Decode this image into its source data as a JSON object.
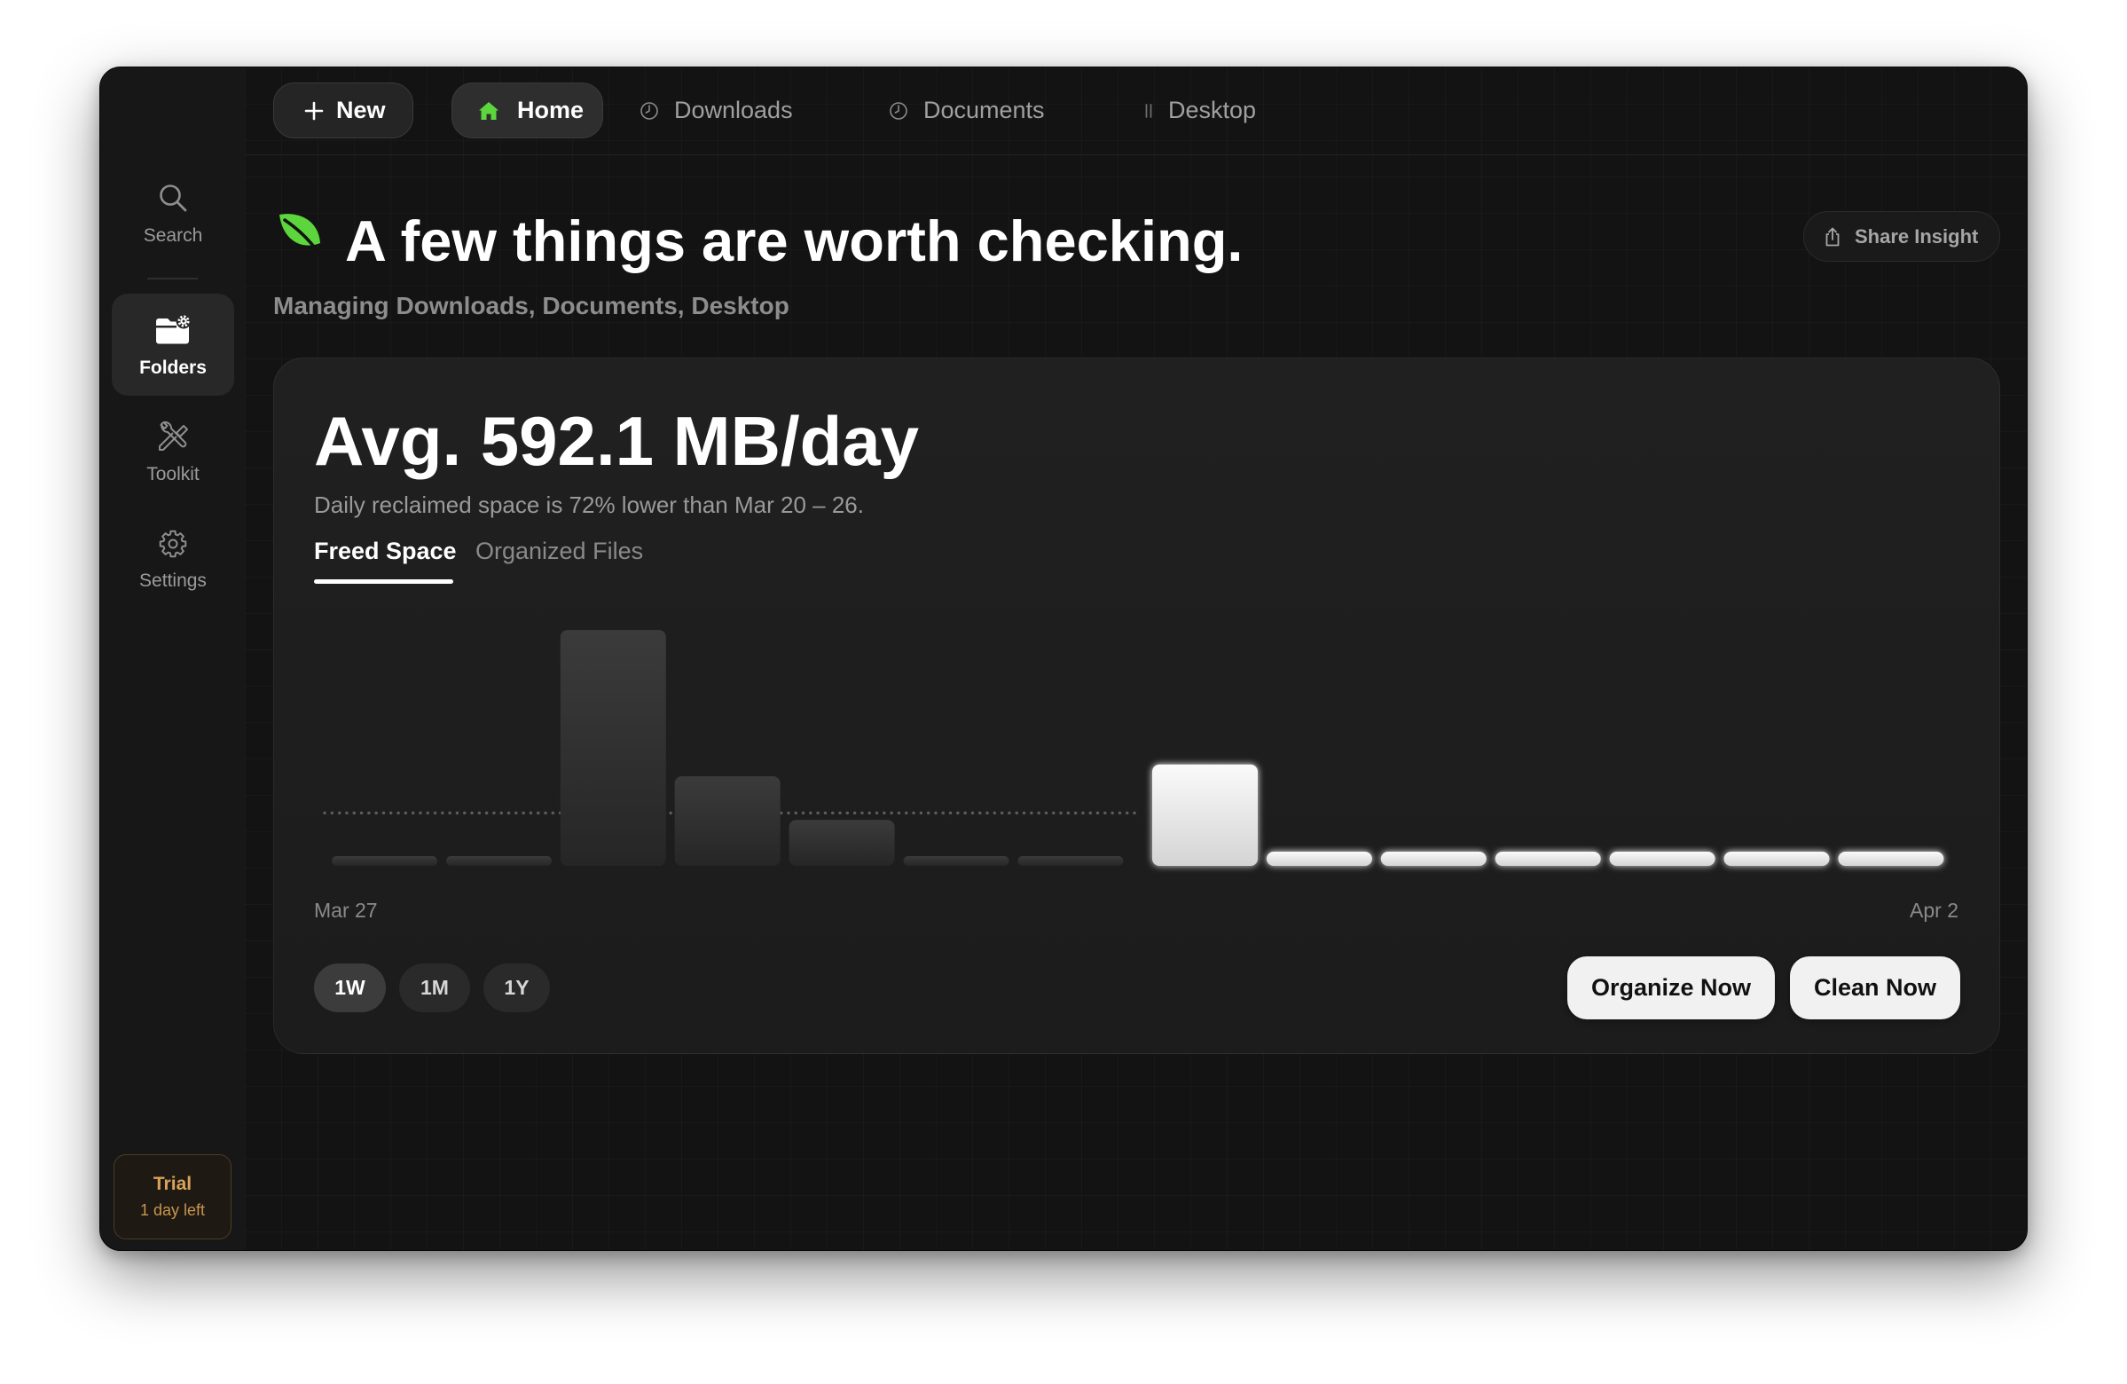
{
  "colors": {
    "accent": "#5cd63c",
    "avg_previous": "#5c5c5c",
    "trial": "#d9a35b",
    "traffic_close": "#ff5f57",
    "traffic_minimize": "#febc2e",
    "traffic_zoom": "#28c840"
  },
  "toolbar": {
    "new_label": "New",
    "new_icon": "plus-icon",
    "tabs": [
      {
        "label": "Home",
        "icon": "home-icon",
        "active": true
      },
      {
        "label": "Downloads",
        "icon": "clock-icon",
        "active": false
      },
      {
        "label": "Documents",
        "icon": "clock-icon",
        "active": false
      },
      {
        "label": "Desktop",
        "icon": "pause-icon",
        "active": false
      }
    ]
  },
  "sidebar": {
    "items": [
      {
        "label": "Search",
        "icon": "search-icon",
        "active": false
      },
      {
        "label": "Folders",
        "icon": "folder-gear-icon",
        "active": true
      },
      {
        "label": "Toolkit",
        "icon": "tools-icon",
        "active": false
      },
      {
        "label": "Settings",
        "icon": "gear-icon",
        "active": false
      }
    ],
    "trial": {
      "title": "Trial",
      "subtitle": "1 day left"
    }
  },
  "header": {
    "icon": "leaf-icon",
    "title": "A few things are worth checking.",
    "subtitle": "Managing Downloads, Documents, Desktop",
    "share_label": "Share Insight",
    "share_icon": "share-icon"
  },
  "insight_card": {
    "headline": "Avg. 592.1 MB/day",
    "comparison": "Daily reclaimed space is 72% lower than Mar 20 – 26.",
    "tabs": [
      {
        "label": "Freed Space",
        "active": true
      },
      {
        "label": "Organized Files",
        "active": false
      }
    ],
    "ranges": [
      {
        "label": "1W",
        "selected": true
      },
      {
        "label": "1M",
        "selected": false
      },
      {
        "label": "1Y",
        "selected": false
      }
    ],
    "organize_label": "Organize Now",
    "clean_label": "Clean Now"
  },
  "chart_data": {
    "type": "bar",
    "tick_labels": [
      "Mar 27",
      "Apr 2"
    ],
    "series": [
      {
        "values": [
          0,
          0,
          9430,
          3580,
          1840,
          0,
          0
        ]
      },
      {
        "values": [
          4050,
          16,
          16,
          16,
          16,
          16,
          16
        ]
      }
    ],
    "averages": [
      2115,
      592.1
    ],
    "ylim": [
      0,
      10000
    ],
    "grid": false,
    "legend": "none"
  }
}
